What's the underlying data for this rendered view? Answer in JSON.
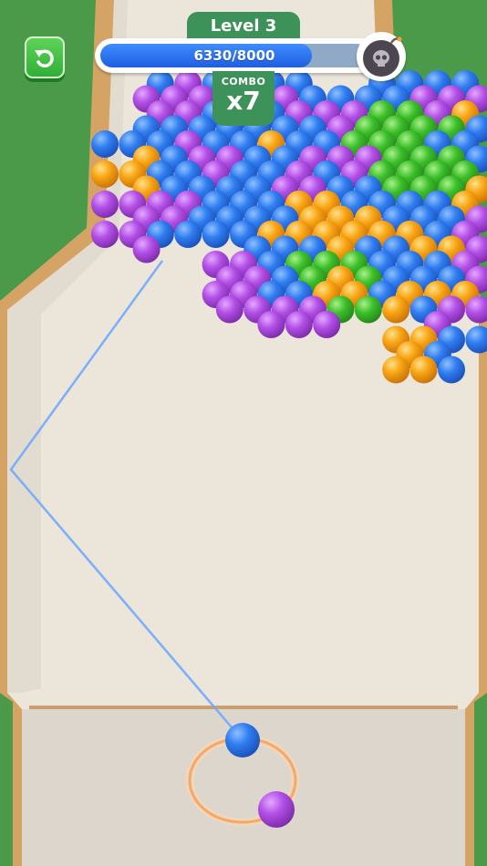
{
  "hud": {
    "level_label": "Level 3",
    "score_text": "6330/8000",
    "score_fraction": 0.79,
    "combo_label": "COMBO",
    "combo_value": "x7"
  },
  "icons": {
    "restart": "restart-icon",
    "bomb": "skull-bomb-icon"
  },
  "colors": {
    "blue": "#2f7df0",
    "purple": "#b24fe6",
    "orange": "#f8a412",
    "green": "#3cbf2a",
    "field": "#ebe5da",
    "wall": "#d5a364",
    "grass": "#4a9a4a",
    "aim_line": "#6fa8ff"
  },
  "shooter": {
    "current_ball": "B",
    "next_ball": "P"
  },
  "board": {
    "legend": {
      "B": "blue",
      "P": "purple",
      "O": "orange",
      "G": "green",
      ".": "empty"
    },
    "rows": [
      "..BPBBBB..BBBB",
      ".PPPBPPBBBBPPP",
      "..PPBBBPPPGGPO",
      ".BBBBBBBPGGGGB",
      "BBBPBBOBBGGGBB",
      ".OBPPBBPPPGGGB",
      "OOBBPBBPBPGGGG",
      ".OBBBBPPBBGGGO",
      "PPPPBBBOOBBBBO",
      ".PPBBBBOOOBBBP",
      "PPBBBBOOOOOOBP",
      ".P...BBBOBBOOP",
      "....PPBGGGBBBP",
      "....PPBGOGBBBP",
      "....PPBBOOBOOO",
      "....PPPPGGOBPP",
      "......PPP...P.",
      "..........OOBB",
      "...........OB.",
      "..........OOB."
    ]
  }
}
